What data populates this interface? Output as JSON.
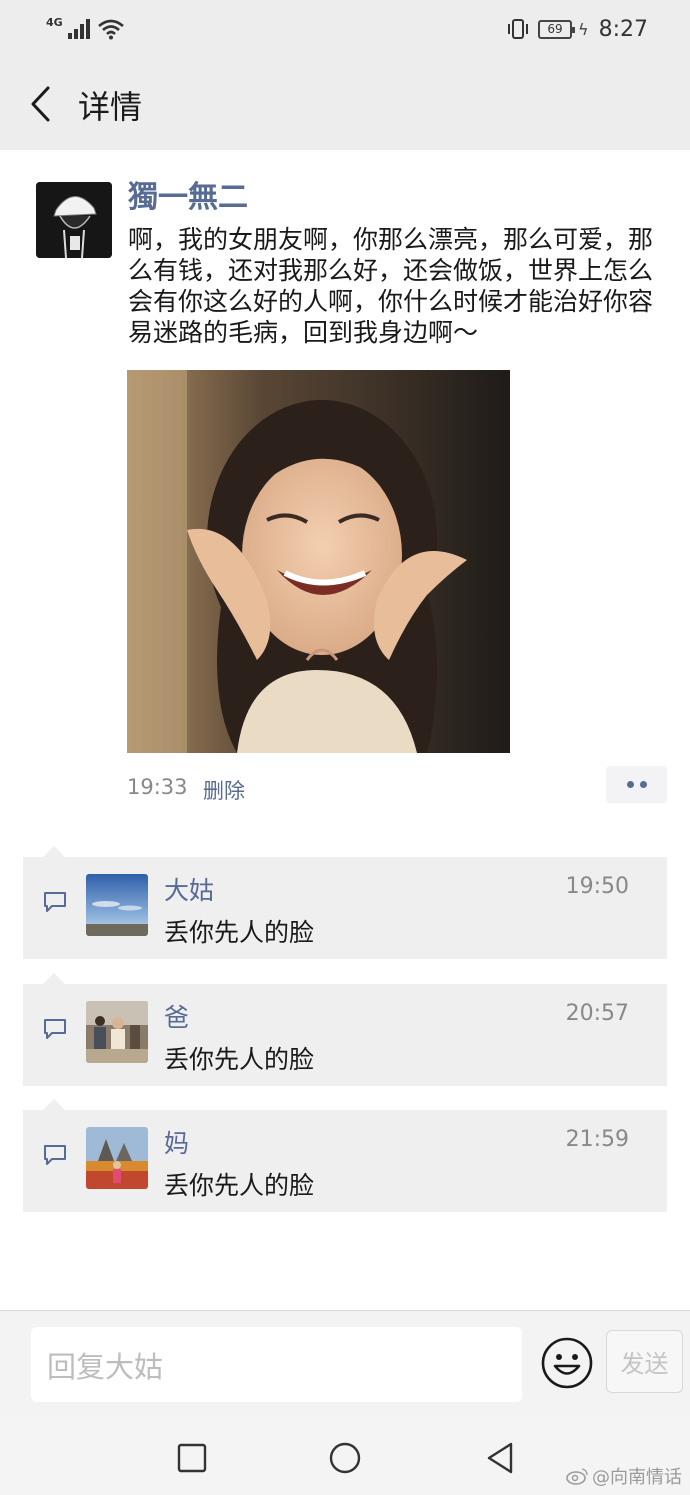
{
  "status_bar": {
    "network_type": "4G",
    "battery_level": "69",
    "time": "8:27",
    "icons": [
      "signal-icon",
      "wifi-icon",
      "vibrate-icon",
      "battery-icon",
      "charging-icon"
    ]
  },
  "header": {
    "title": "详情",
    "back_icon": "chevron-left-icon"
  },
  "post": {
    "author": "獨一無二",
    "text": "啊，我的女朋友啊，你那么漂亮，那么可爱，那么有钱，还对我那么好，还会做饭，世界上怎么会有你这么好的人啊，你什么时候才能治好你容易迷路的毛病，回到我身边啊～",
    "time": "19:33",
    "delete_label": "删除",
    "more_icon": "more-dots-icon"
  },
  "comments": [
    {
      "name": "大姑",
      "text": "丢你先人的脸",
      "time": "19:50"
    },
    {
      "name": "爸",
      "text": "丢你先人的脸",
      "time": "20:57"
    },
    {
      "name": "妈",
      "text": "丢你先人的脸",
      "time": "21:59"
    }
  ],
  "reply_bar": {
    "placeholder": "回复大姑",
    "send_label": "发送",
    "emoji_icon": "smiley-icon"
  },
  "nav_bar": {
    "icons": [
      "recents-square-icon",
      "home-circle-icon",
      "back-triangle-icon"
    ]
  },
  "watermark": {
    "text": "@向南情话",
    "icon": "weibo-icon"
  },
  "colors": {
    "link": "#576b95",
    "header_bg": "#ededed",
    "comment_bg": "#efefef"
  }
}
